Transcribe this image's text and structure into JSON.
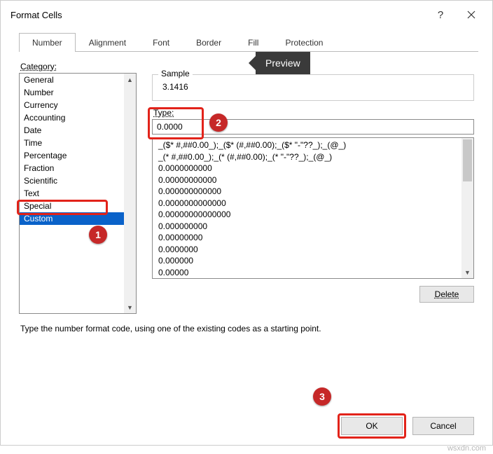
{
  "title": "Format Cells",
  "tabs": [
    "Number",
    "Alignment",
    "Font",
    "Border",
    "Fill",
    "Protection"
  ],
  "active_tab_index": 0,
  "category_label": "Category:",
  "categories": [
    "General",
    "Number",
    "Currency",
    "Accounting",
    "Date",
    "Time",
    "Percentage",
    "Fraction",
    "Scientific",
    "Text",
    "Special",
    "Custom"
  ],
  "selected_category_index": 11,
  "sample_label": "Sample",
  "sample_value": "3.1416",
  "type_label": "Type:",
  "type_value": "0.0000",
  "format_list": [
    "_($* #,##0.00_);_($* (#,##0.00);_($* \"-\"??_);_(@_)",
    "_(* #,##0.00_);_(* (#,##0.00);_(* \"-\"??_);_(@_)",
    "0.0000000000",
    "0.00000000000",
    "0.000000000000",
    "0.0000000000000",
    "0.00000000000000",
    "0.000000000",
    "0.00000000",
    "0.0000000",
    "0.000000",
    "0.00000"
  ],
  "delete_label": "Delete",
  "instruction": "Type the number format code, using one of the existing codes as a starting point.",
  "ok_label": "OK",
  "cancel_label": "Cancel",
  "annotations": {
    "preview_label": "Preview",
    "badge1": "1",
    "badge2": "2",
    "badge3": "3"
  },
  "watermark": "wsxdn.com"
}
